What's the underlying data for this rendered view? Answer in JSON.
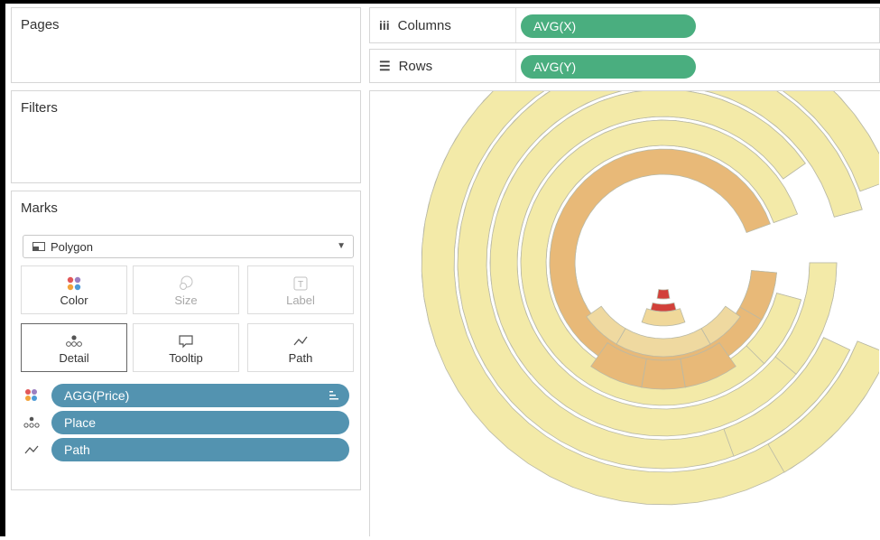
{
  "pages": {
    "title": "Pages"
  },
  "filters": {
    "title": "Filters"
  },
  "marks": {
    "title": "Marks",
    "mark_type": "Polygon",
    "buttons": {
      "color": "Color",
      "size": "Size",
      "label": "Label",
      "detail": "Detail",
      "tooltip": "Tooltip",
      "path": "Path"
    },
    "fields": [
      {
        "label": "AGG(Price)",
        "encoding": "color-icon"
      },
      {
        "label": "Place",
        "encoding": "detail-icon"
      },
      {
        "label": "Path",
        "encoding": "path-icon"
      }
    ]
  },
  "shelves": {
    "columns": {
      "label": "Columns",
      "pill": "AVG(X)"
    },
    "rows": {
      "label": "Rows",
      "pill": "AVG(Y)"
    }
  },
  "colors": {
    "pill_green": "#4aae7f",
    "pill_blue": "#5393b0",
    "seat_light": "#f3eaa8",
    "seat_mid": "#e8b978",
    "seat_dark": "#d2413a"
  }
}
